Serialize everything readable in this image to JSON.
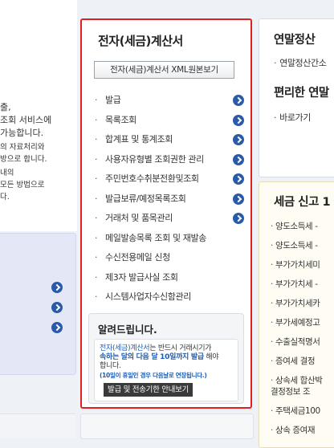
{
  "left": {
    "text1_lines": [
      "출,",
      "조회 서비스에",
      "가능합니다."
    ],
    "text2_lines": [
      "의 자료처리와",
      "방으로 합니다.",
      "내의",
      "모든 방법으로",
      "다."
    ]
  },
  "einvoice": {
    "title": "전자(세금)계산서",
    "xml_button": "전자(세금)계산서 XML원본보기",
    "menu": [
      {
        "label": "발급",
        "arrow": true
      },
      {
        "label": "목록조회",
        "arrow": true
      },
      {
        "label": "합계표 및 통계조회",
        "arrow": true
      },
      {
        "label": "사용자유형별 조회권한 관리",
        "arrow": true
      },
      {
        "label": "주민번호수취분전환및조회",
        "arrow": true
      },
      {
        "label": "발급보류/예정목록조회",
        "arrow": true
      },
      {
        "label": "거래처 및 품목관리",
        "arrow": true
      },
      {
        "label": "메일발송목록 조회 및 재발송",
        "arrow": false
      },
      {
        "label": "수신전용메일 신청",
        "arrow": false
      },
      {
        "label": "제3자 발급사실 조회",
        "arrow": false
      },
      {
        "label": "시스템사업자수신함관리",
        "arrow": false
      }
    ],
    "notice": {
      "title": "알려드립니다.",
      "text_part1": "전자(세금)계산서",
      "text_part2": "는 반드시 거래시기가",
      "text_part3": "속하는 달의 다음 달 10일까지 발급",
      "text_part4": " 해야",
      "text_part5": "합니다.",
      "sub": "(10일이 휴일인 경우 다음날로 연장됩니다.)",
      "button": "발급 및 전송기한 안내보기"
    }
  },
  "year_end": {
    "title": "연말정산",
    "item": "연말정산간소",
    "title2": "편리한 연말",
    "item2": "바로가기"
  },
  "tax_report": {
    "title": "세금 신고 1",
    "items": [
      "양도소득세 -",
      "양도소득세 -",
      "부가가치세미",
      "부가가치세 -",
      "부가가치세카",
      "부가세예정고",
      "수출실적명서",
      "증여세 결정",
      "상속세 합산박|결정정보 조",
      "주택세금100",
      "상속 증여재"
    ]
  }
}
